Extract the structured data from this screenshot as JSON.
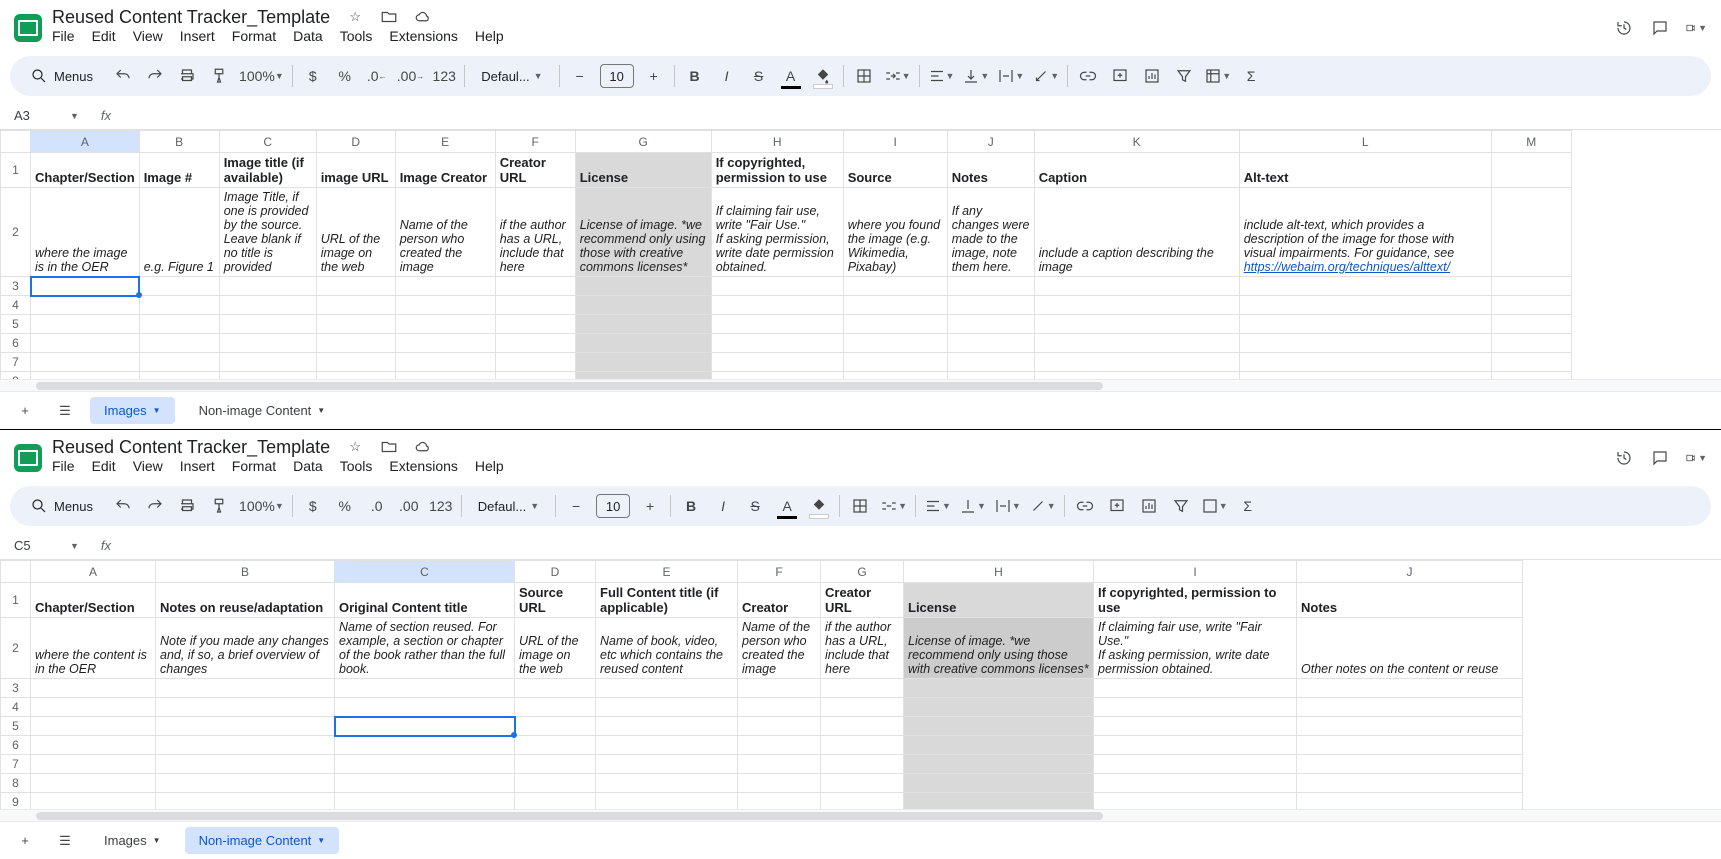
{
  "doc": {
    "title": "Reused Content Tracker_Template"
  },
  "menu": [
    "File",
    "Edit",
    "View",
    "Insert",
    "Format",
    "Data",
    "Tools",
    "Extensions",
    "Help"
  ],
  "toolbar": {
    "search": "Menus",
    "zoom": "100%",
    "font": "Defaul...",
    "size": "10",
    "fmt_auto": "123"
  },
  "pane1": {
    "cellref": "A3",
    "cols": [
      "A",
      "B",
      "C",
      "D",
      "E",
      "F",
      "G",
      "H",
      "I",
      "J",
      "K",
      "L",
      "M"
    ],
    "widths": [
      92,
      80,
      97,
      79,
      100,
      80,
      136,
      132,
      104,
      87,
      205,
      252,
      80
    ],
    "headers": [
      "Chapter/Section",
      "Image #",
      "Image title (if available)",
      "image URL",
      "Image Creator",
      "Creator URL",
      "License",
      "If copyrighted, permission to use",
      "Source",
      "Notes",
      "Caption",
      "Alt-text",
      ""
    ],
    "hints": [
      "where the image is in the OER",
      "e.g. Figure 1",
      "Image Title, if one is provided by the source. Leave blank if no title is provided",
      "URL of the image on the web",
      "Name of the person who created the image",
      "if the author has a URL, include that here",
      "License of image. *we recommend only using those with creative commons licenses*",
      "If claiming fair use, write \"Fair Use.\"\nIf asking permission, write date permission obtained.",
      "where you found the image (e.g. Wikimedia, Pixabay)",
      "If any changes were made to the image, note them here.",
      "include a caption describing the image",
      "include alt-text, which provides a description of the image for those with visual impairments. For guidance, see ",
      ""
    ],
    "alt_link": "https://webaim.org/techniques/alttext/",
    "tabs": [
      {
        "label": "Images",
        "active": true
      },
      {
        "label": "Non-image Content",
        "active": false
      }
    ]
  },
  "pane2": {
    "cellref": "C5",
    "cols": [
      "A",
      "B",
      "C",
      "D",
      "E",
      "F",
      "G",
      "H",
      "I",
      "J"
    ],
    "widths": [
      125,
      179,
      180,
      81,
      142,
      83,
      83,
      190,
      203,
      226
    ],
    "headers": [
      "Chapter/Section",
      "Notes on reuse/adaptation",
      "Original Content title",
      "Source URL",
      "Full Content title (if applicable)",
      "Creator",
      "Creator URL",
      "License",
      "If copyrighted, permission to use",
      "Notes"
    ],
    "hints": [
      "where the content is in the OER",
      "Note if you made any changes and, if so, a brief overview of changes",
      "Name of section reused. For example, a section or chapter of the book rather than the full book.",
      "URL of the image on the web",
      "Name of book, video, etc which contains the reused content",
      "Name of the person who created the image",
      "if the author has a URL, include that here",
      "License of image. *we recommend only using those with creative commons licenses*",
      "If claiming fair use, write \"Fair Use.\"\nIf asking permission, write date permission obtained.",
      "Other notes on the content or reuse"
    ],
    "tabs": [
      {
        "label": "Images",
        "active": false
      },
      {
        "label": "Non-image Content",
        "active": true
      }
    ]
  }
}
